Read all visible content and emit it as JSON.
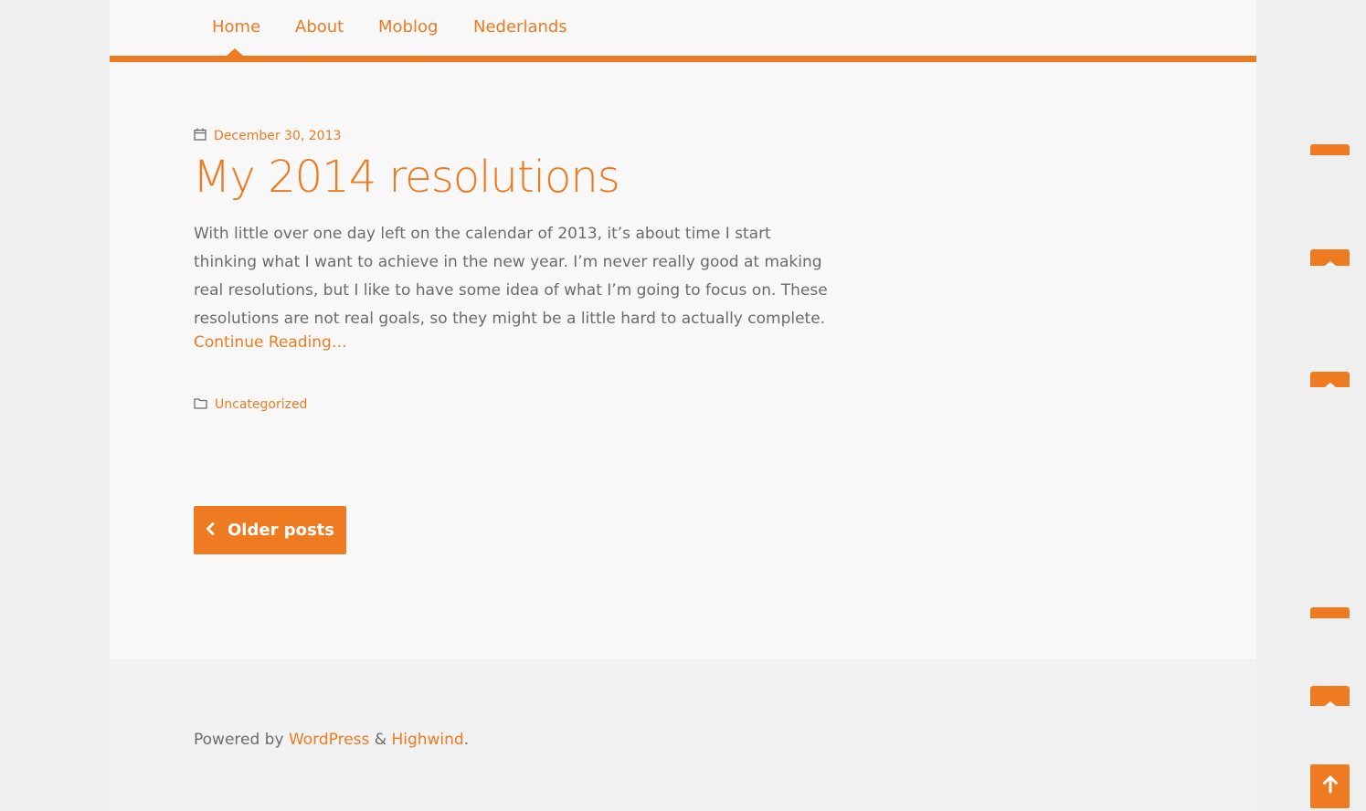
{
  "nav": {
    "items": [
      {
        "label": "Home"
      },
      {
        "label": "About"
      },
      {
        "label": "Moblog"
      },
      {
        "label": "Nederlands"
      }
    ]
  },
  "post": {
    "date": "December 30, 2013",
    "title": "My 2014 resolutions",
    "excerpt": "With little over one day left on the calendar of 2013, it’s about time I start thinking what I want to achieve in the new year. I’m never really good at making real resolutions, but I like to have some idea of what I’m going to focus on. These resolutions are not real goals, so they might be a little hard to actually complete.",
    "continue_label": "Continue Reading…",
    "category": "Uncategorized"
  },
  "pagination": {
    "older_label": "Older posts"
  },
  "footer": {
    "prefix": "Powered by ",
    "wordpress": "WordPress",
    "amp": " & ",
    "highwind": "Highwind",
    "suffix": "."
  },
  "icons": {
    "calendar": "calendar-icon",
    "folder": "folder-icon",
    "chevron": "chevron-left-icon",
    "up": "arrow-up-icon"
  },
  "colors": {
    "accent": "#ee7b22",
    "text": "#6b6b6b",
    "background": "#f8f8f8"
  }
}
